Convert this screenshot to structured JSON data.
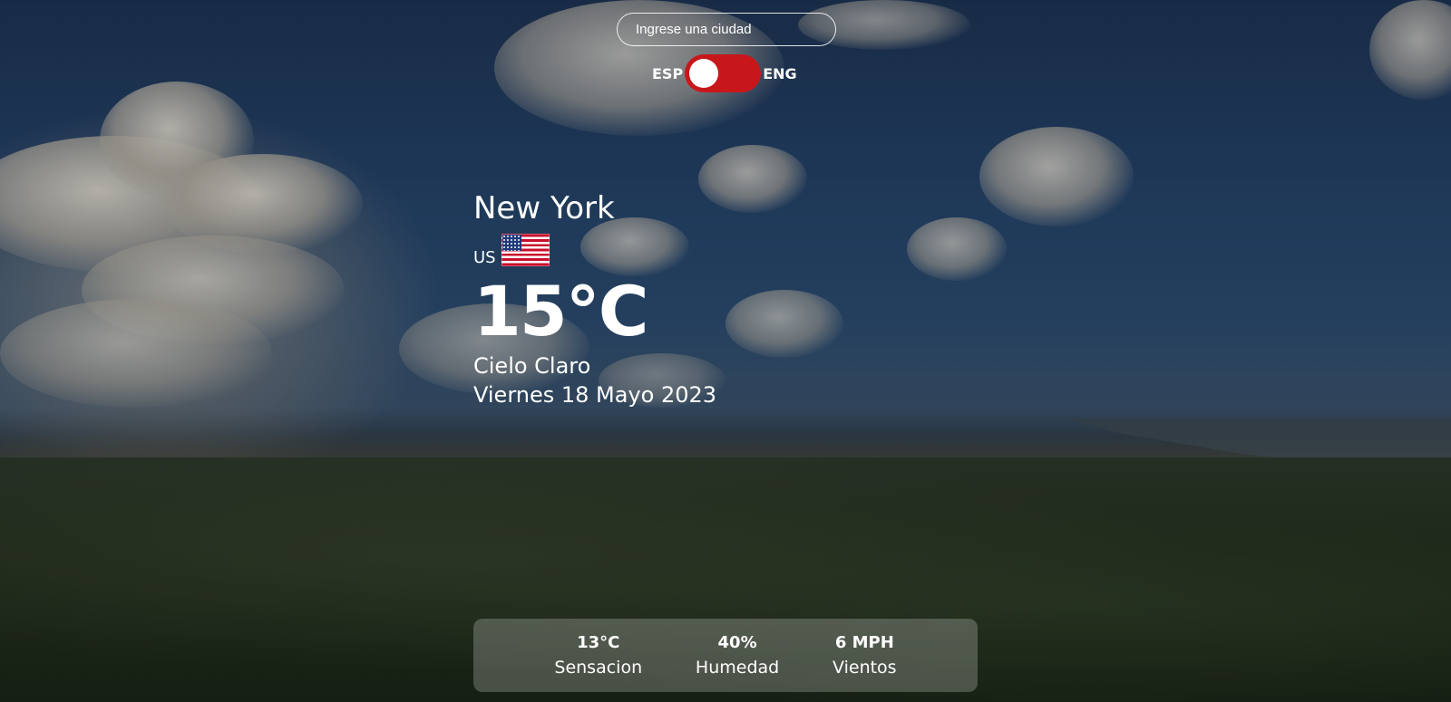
{
  "search": {
    "placeholder": "Ingrese una ciudad"
  },
  "language_toggle": {
    "left_label": "ESP",
    "right_label": "ENG",
    "selected": "ESP",
    "track_color": "#c8171b"
  },
  "weather": {
    "city": "New York",
    "country_code": "US",
    "flag_icon": "us-flag-icon",
    "temperature": "15°C",
    "description": "Cielo Claro",
    "date": "Viernes 18 Mayo 2023"
  },
  "stats": [
    {
      "value": "13°C",
      "label": "Sensacion"
    },
    {
      "value": "40%",
      "label": "Humedad"
    },
    {
      "value": "6 MPH",
      "label": "Vientos"
    }
  ]
}
